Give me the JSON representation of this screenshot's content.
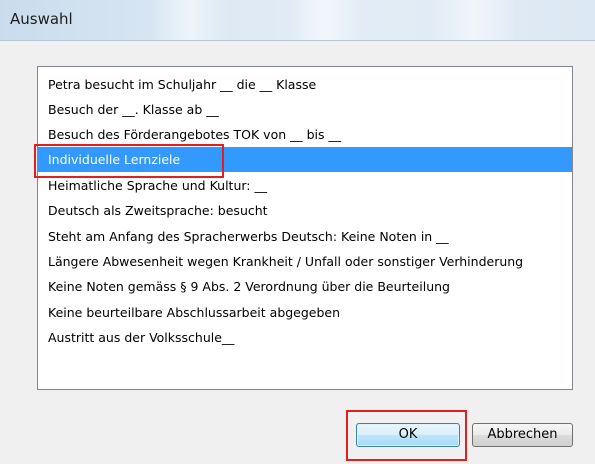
{
  "window": {
    "title": "Auswahl"
  },
  "list": {
    "items": [
      "Petra besucht im Schuljahr __ die __ Klasse",
      "Besuch der __. Klasse ab __",
      "Besuch des Förderangebotes TOK von __ bis __",
      "Individuelle Lernziele",
      "Heimatliche Sprache und Kultur: __",
      "Deutsch als Zweitsprache: besucht",
      "Steht am Anfang des Spracherwerbs Deutsch: Keine Noten in __",
      "Längere Abwesenheit wegen Krankheit / Unfall oder sonstiger Verhinderung",
      "Keine Noten gemäss § 9 Abs. 2 Verordnung über die Beurteilung",
      "Keine beurteilbare Abschlussarbeit abgegeben",
      "Austritt aus der Volksschule__"
    ],
    "selected_index": 3
  },
  "buttons": {
    "ok_label": "OK",
    "cancel_label": "Abbrechen"
  },
  "colors": {
    "selection": "#3399ff",
    "annotation": "#e02020",
    "default_button_border": "#3c7fb1"
  }
}
